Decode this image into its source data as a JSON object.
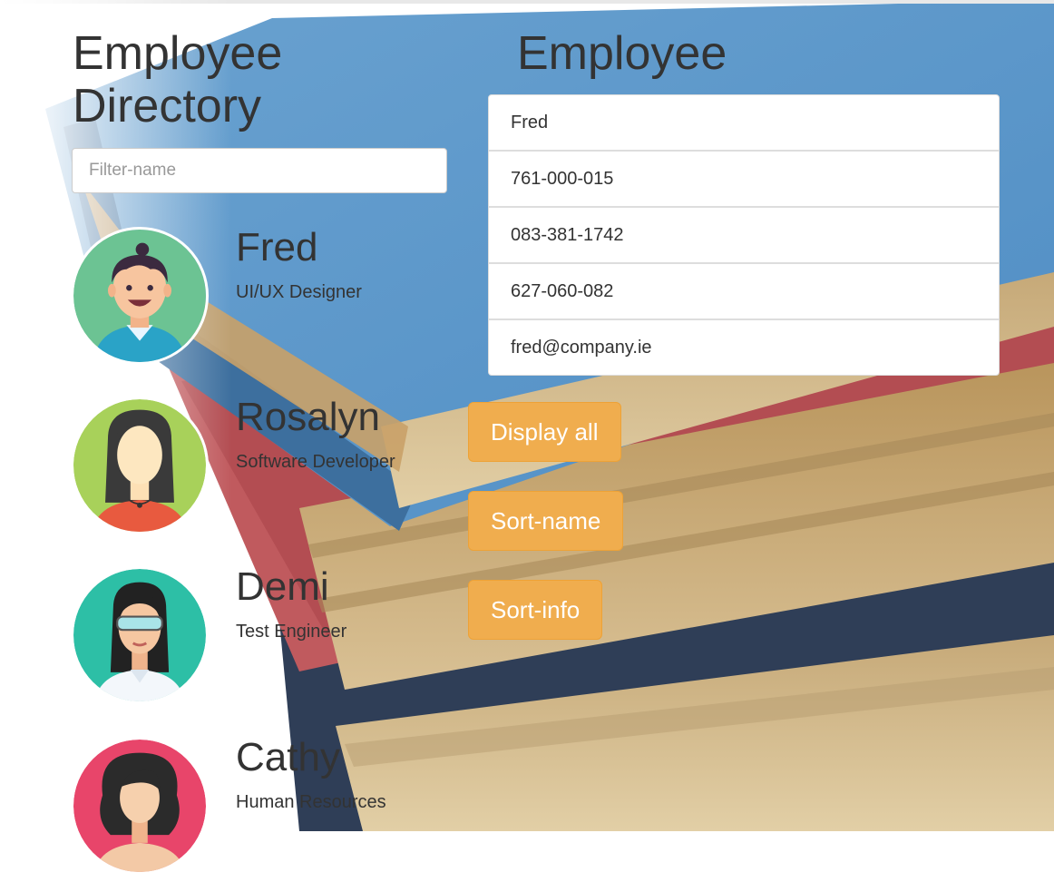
{
  "directory": {
    "title": "Employee Directory",
    "filter_placeholder": "Filter-name",
    "employees": [
      {
        "name": "Fred",
        "role": "UI/UX Designer"
      },
      {
        "name": "Rosalyn",
        "role": "Software Developer"
      },
      {
        "name": "Demi",
        "role": "Test Engineer"
      },
      {
        "name": "Cathy",
        "role": "Human Resources"
      }
    ]
  },
  "details": {
    "title": "Employee",
    "fields": [
      "Fred",
      "761-000-015",
      "083-381-1742",
      "627-060-082",
      "fred@company.ie"
    ]
  },
  "buttons": {
    "display_all": "Display all",
    "sort_name": "Sort-name",
    "sort_info": "Sort-info"
  },
  "colors": {
    "button_accent": "#f0ad4e",
    "text": "#333333"
  }
}
